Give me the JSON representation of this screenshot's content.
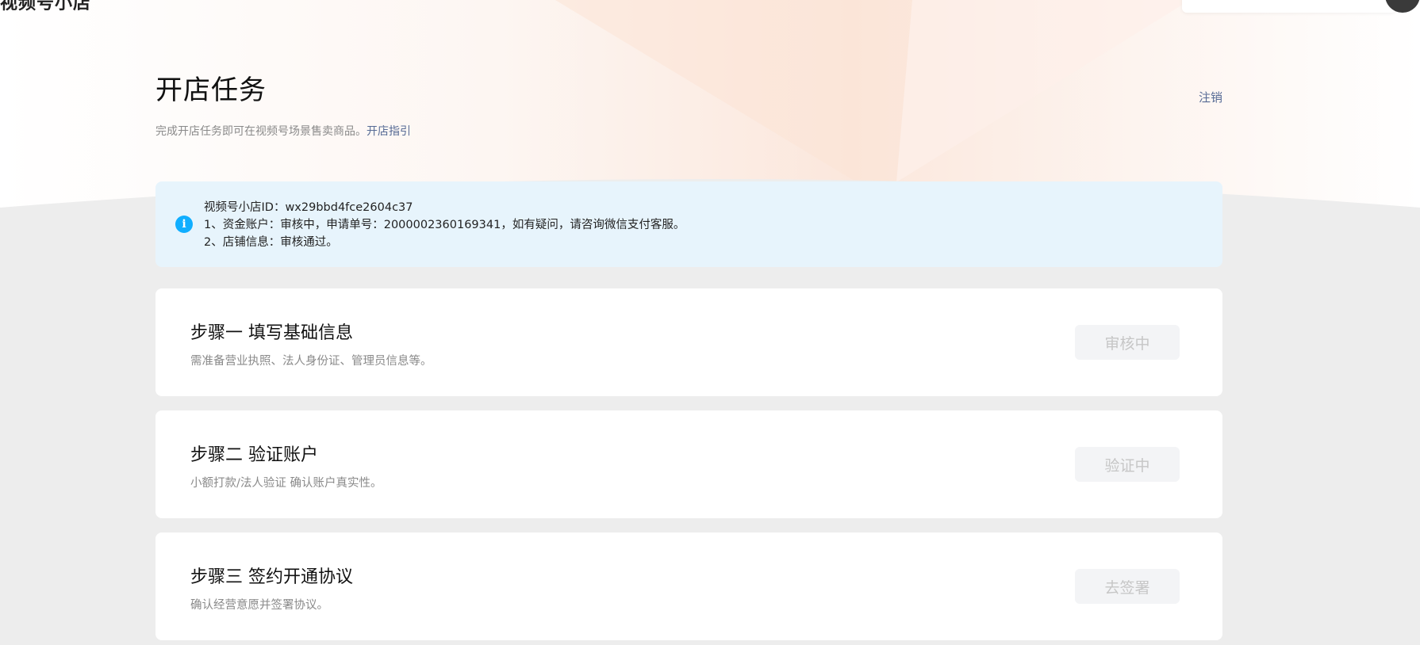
{
  "app": {
    "brand": "视频号小店"
  },
  "header": {
    "title": "开店任务",
    "subtitle": "完成开店任务即可在视频号场景售卖商品。",
    "guide_link": "开店指引",
    "cancel_link": "注销"
  },
  "notice": {
    "icon": "info-icon",
    "icon_glyph": "i",
    "lines": [
      "视频号小店ID：wx29bbd4fce2604c37",
      "1、资金账户：审核中，申请单号：2000002360169341，如有疑问，请咨询微信支付客服。",
      "2、店铺信息：审核通过。"
    ]
  },
  "steps": [
    {
      "title": "步骤一 填写基础信息",
      "desc": "需准备营业执照、法人身份证、管理员信息等。",
      "button": "审核中"
    },
    {
      "title": "步骤二 验证账户",
      "desc": "小额打款/法人验证 确认账户真实性。",
      "button": "验证中"
    },
    {
      "title": "步骤三 签约开通协议",
      "desc": "确认经营意愿并签署协议。",
      "button": "去签署"
    }
  ],
  "colors": {
    "link": "#576b95",
    "info_accent": "#10aeff",
    "notice_bg": "#e7f4fc",
    "page_bg": "#ededed",
    "disabled_button_bg": "#f3f4f6",
    "disabled_button_text": "#c6c6c6"
  }
}
